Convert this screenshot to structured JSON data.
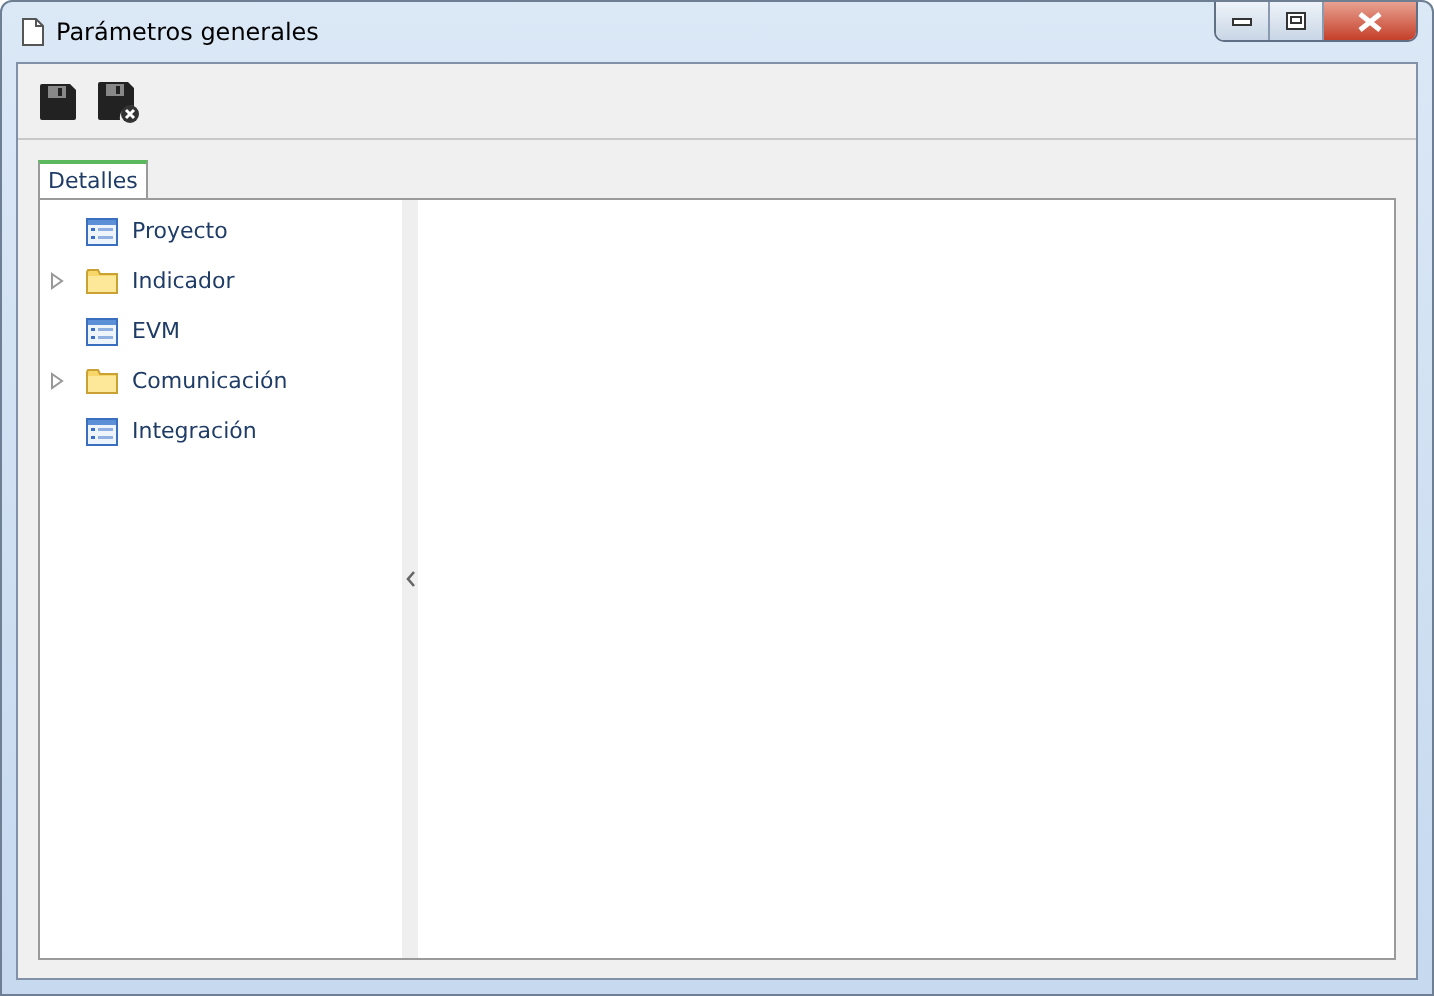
{
  "window": {
    "title": "Parámetros generales"
  },
  "toolbar": [
    {
      "kind": "save"
    },
    {
      "kind": "save-close"
    }
  ],
  "tabs": [
    {
      "label": "Detalles",
      "selected": true
    }
  ],
  "tree": [
    {
      "label": "Proyecto",
      "kind": "form"
    },
    {
      "label": "Indicador",
      "kind": "folder",
      "expanded": false
    },
    {
      "label": "EVM",
      "kind": "form"
    },
    {
      "label": "Comunicación",
      "kind": "folder",
      "expanded": false
    },
    {
      "label": "Integración",
      "kind": "form"
    }
  ]
}
